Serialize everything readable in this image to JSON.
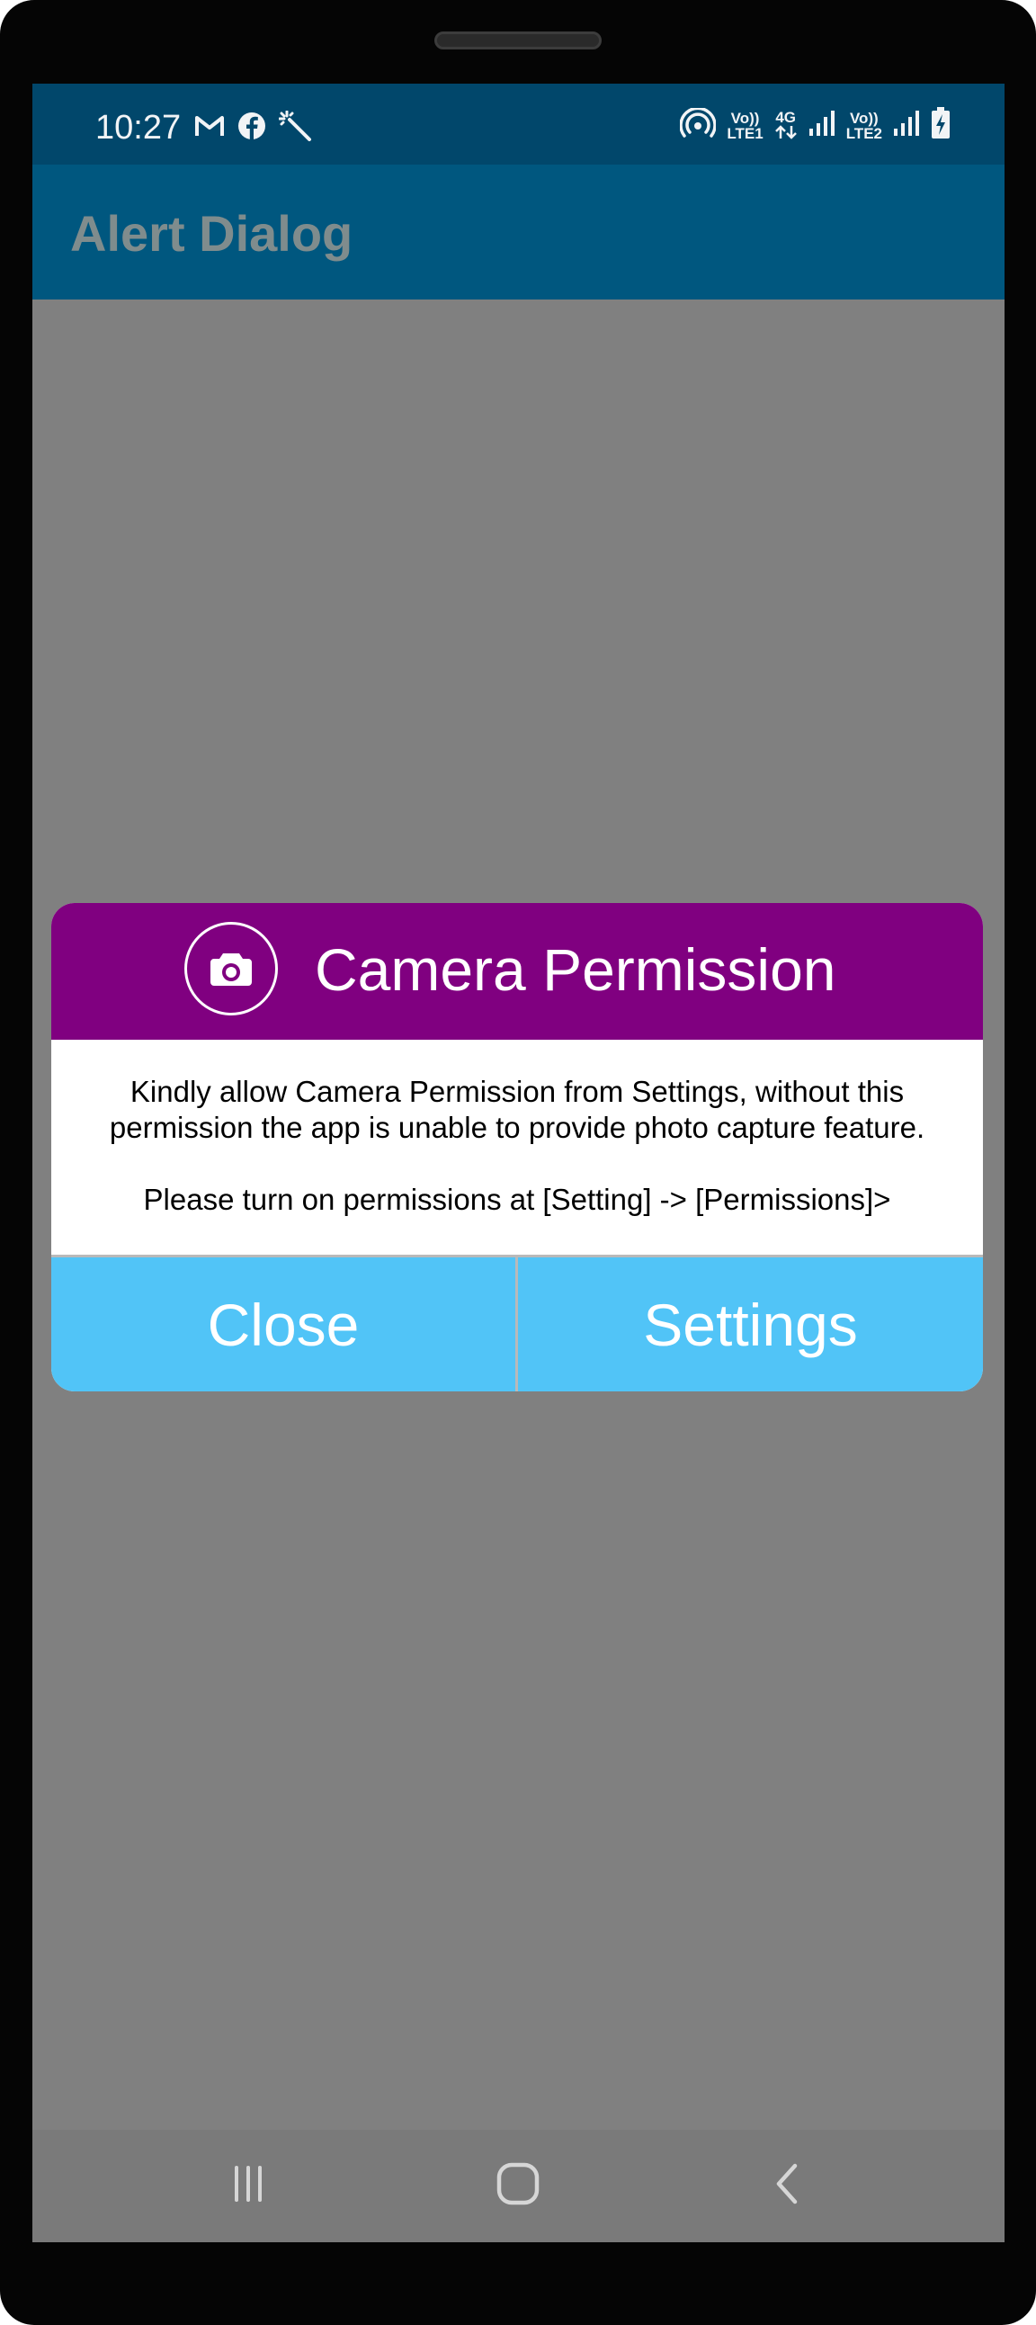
{
  "status_bar": {
    "time": "10:27",
    "left_icons": [
      "gmail-icon",
      "facebook-icon",
      "magic-wand-icon"
    ],
    "right_icons": [
      "hotspot-icon",
      "volte-lte1-icon",
      "4g-data-icon",
      "signal-icon",
      "volte-lte2-icon",
      "signal-icon",
      "battery-charging-icon"
    ],
    "sim1_top": "Vo))",
    "sim1_bottom": "LTE1",
    "data_type": "4G",
    "sim2_top": "Vo))",
    "sim2_bottom": "LTE2"
  },
  "app_bar": {
    "title": "Alert Dialog"
  },
  "dialog": {
    "icon": "camera-icon",
    "title": "Camera Permission",
    "message": "Kindly allow Camera Permission from Settings, without this permission the app is unable to provide photo capture feature.",
    "hint": "Please turn on permissions at [Setting] -> [Permissions]>",
    "close_label": "Close",
    "settings_label": "Settings"
  },
  "nav_bar": {
    "buttons": [
      "recent-apps-icon",
      "home-icon",
      "back-icon"
    ]
  },
  "colors": {
    "status_bar": "#01476b",
    "app_bar": "#00577f",
    "scrim": "#808080",
    "dialog_header": "#800080",
    "dialog_buttons": "#51c4f7",
    "nav_bar": "#7a7a7a"
  }
}
